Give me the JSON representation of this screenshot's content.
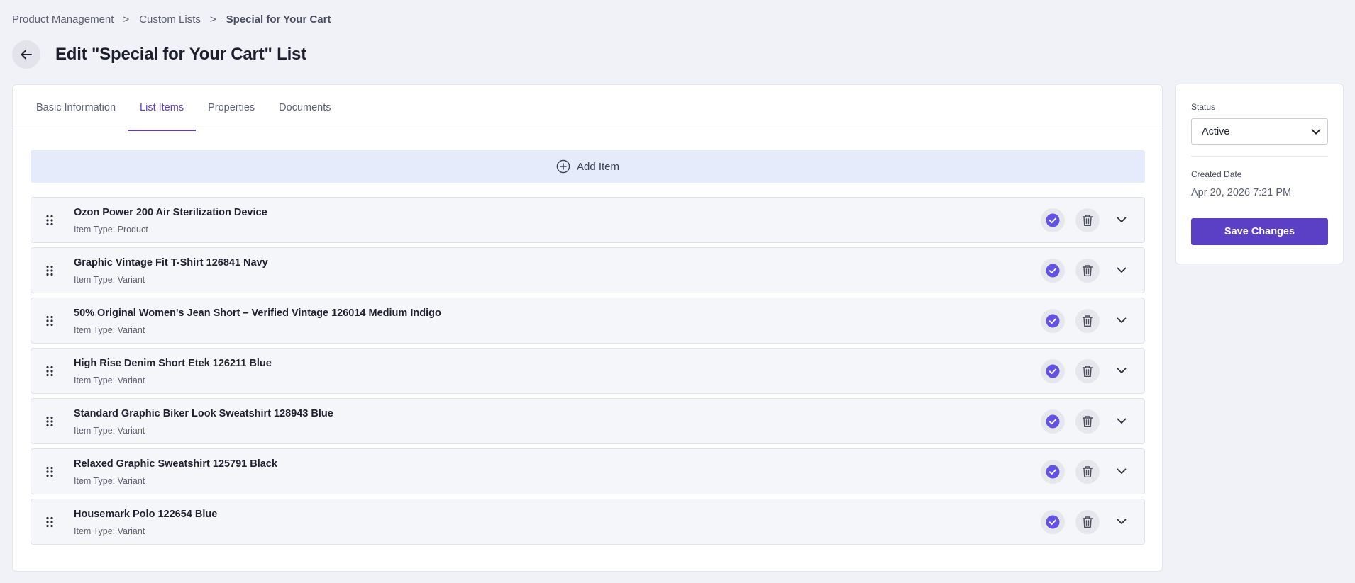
{
  "breadcrumb": {
    "items": [
      "Product Management",
      "Custom Lists",
      "Special for Your Cart"
    ],
    "separator": ">"
  },
  "header": {
    "back_icon": "arrow-left-icon",
    "title": "Edit \"Special for Your Cart\" List"
  },
  "tabs": [
    {
      "label": "Basic Information",
      "active": false
    },
    {
      "label": "List Items",
      "active": true
    },
    {
      "label": "Properties",
      "active": false
    },
    {
      "label": "Documents",
      "active": false
    }
  ],
  "add_item": {
    "label": "Add Item",
    "icon": "plus-circle-icon"
  },
  "items": [
    {
      "name": "Ozon Power 200 Air Sterilization Device",
      "type": "Item Type: Product"
    },
    {
      "name": "Graphic Vintage Fit T-Shirt 126841 Navy",
      "type": "Item Type: Variant"
    },
    {
      "name": "50% Original Women's Jean Short – Verified Vintage 126014 Medium Indigo",
      "type": "Item Type: Variant"
    },
    {
      "name": "High Rise Denim Short Etek 126211 Blue",
      "type": "Item Type: Variant"
    },
    {
      "name": "Standard Graphic Biker Look Sweatshirt 128943 Blue",
      "type": "Item Type: Variant"
    },
    {
      "name": "Relaxed Graphic Sweatshirt 125791 Black",
      "type": "Item Type: Variant"
    },
    {
      "name": "Housemark Polo 122654 Blue",
      "type": "Item Type: Variant"
    }
  ],
  "sidebar": {
    "status_label": "Status",
    "status_value": "Active",
    "created_label": "Created Date",
    "created_value": "Apr 20, 2026 7:21 PM",
    "save_label": "Save Changes"
  },
  "colors": {
    "accent": "#5b3fc4",
    "check": "#6352e6",
    "background": "#f1f2f7",
    "add_item_bg": "#e5ebfb"
  }
}
